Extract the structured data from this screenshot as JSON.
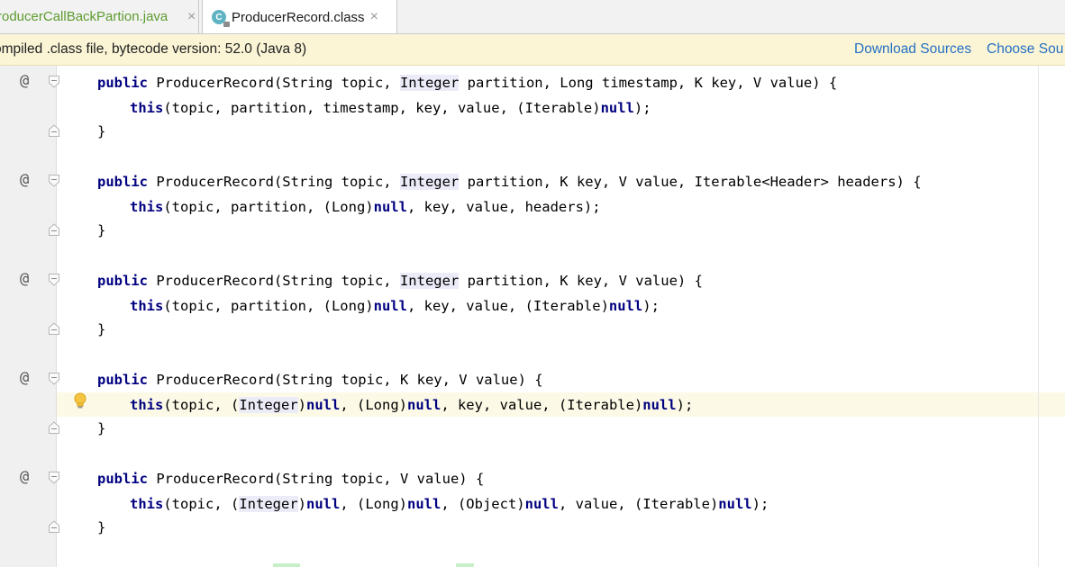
{
  "tabs": [
    {
      "label": "ProducerCallBackPartion.java",
      "visible_label": "roducerCallBackPartion.java",
      "active": false
    },
    {
      "label": "ProducerRecord.class",
      "active": true
    }
  ],
  "tab_icon_letter": "C",
  "close_glyph": "×",
  "banner": {
    "message": "ompiled .class file, bytecode version: 52.0 (Java 8)",
    "download_sources": "Download Sources",
    "choose_sources": "Choose Sou"
  },
  "gutter_marker": "@",
  "code": {
    "m1_sig_kw": "public",
    "m1_sig_a": " ProducerRecord(String topic, ",
    "m1_sig_hl": "Integer",
    "m1_sig_b": " partition, Long timestamp, K key, V value) {",
    "m1_body_kw": "this",
    "m1_body_a": "(topic, partition, timestamp, key, value, (Iterable)",
    "m1_body_null": "null",
    "m1_body_b": ");",
    "close_brace": "}",
    "m2_sig_kw": "public",
    "m2_sig_a": " ProducerRecord(String topic, ",
    "m2_sig_hl": "Integer",
    "m2_sig_b": " partition, K key, V value, Iterable<Header> headers) {",
    "m2_body_kw": "this",
    "m2_body_a": "(topic, partition, (Long)",
    "m2_body_null": "null",
    "m2_body_b": ", key, value, headers);",
    "m3_sig_kw": "public",
    "m3_sig_a": " ProducerRecord(String topic, ",
    "m3_sig_hl": "Integer",
    "m3_sig_b": " partition, K key, V value) {",
    "m3_body_kw": "this",
    "m3_body_a": "(topic, partition, (Long)",
    "m3_body_null1": "null",
    "m3_body_mid": ", key, value, (Iterable)",
    "m3_body_null2": "null",
    "m3_body_b": ");",
    "m4_sig_kw": "public",
    "m4_sig_a": " ProducerRecord(String topic, K key, V value) {",
    "m4_body_kw": "this",
    "m4_body_a": "(topic, (",
    "m4_body_hl": "Integer",
    "m4_body_c": ")",
    "m4_body_null1": "null",
    "m4_body_d": ", (Long)",
    "m4_body_null2": "null",
    "m4_body_e": ", key, value, (Iterable)",
    "m4_body_null3": "null",
    "m4_body_f": ");",
    "m5_sig_kw": "public",
    "m5_sig_a": " ProducerRecord(String topic, V value) {",
    "m5_body_kw": "this",
    "m5_body_a": "(topic, (",
    "m5_body_hl": "Integer",
    "m5_body_c": ")",
    "m5_body_null1": "null",
    "m5_body_d": ", (Long)",
    "m5_body_null2": "null",
    "m5_body_e": ", (Object)",
    "m5_body_null3": "null",
    "m5_body_f": ", value, (Iterable)",
    "m5_body_null4": "null",
    "m5_body_g": ");"
  },
  "colors": {
    "keyword": "#000080",
    "link": "#2470c2",
    "banner_bg": "#fbf5d6",
    "current_line": "#fcfae6",
    "usage_highlight": "#ecebf8",
    "inactive_tab_text": "#5d9b2f"
  },
  "icons": [
    "class-file-icon",
    "close-icon",
    "override-marker-icon",
    "fold-icon",
    "intention-bulb-icon"
  ]
}
